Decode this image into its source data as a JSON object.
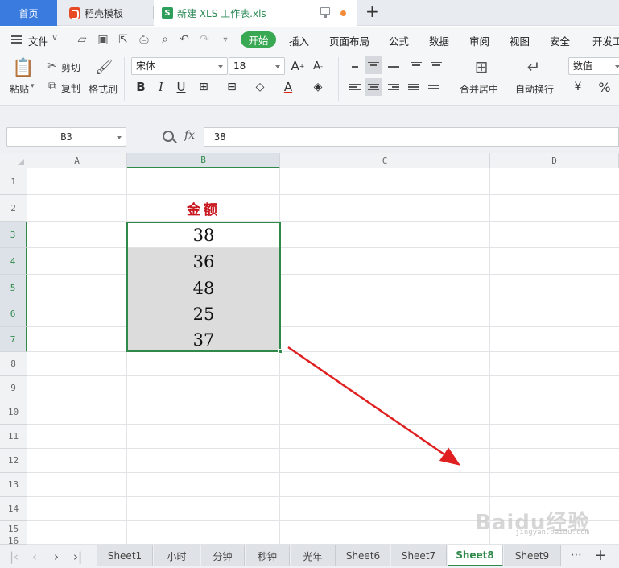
{
  "tabs": {
    "home": "首页",
    "docer": "稻壳模板",
    "document": "新建 XLS 工作表.xls",
    "xls_badge": "S"
  },
  "menu": {
    "file": "文件",
    "items": [
      "开始",
      "插入",
      "页面布局",
      "公式",
      "数据",
      "审阅",
      "视图",
      "安全",
      "开发工"
    ]
  },
  "ribbon": {
    "paste": "粘贴",
    "cut": "剪切",
    "copy": "复制",
    "format_painter": "格式刷",
    "font_name": "宋体",
    "font_size": "18",
    "merge_center": "合并居中",
    "wrap_text": "自动换行",
    "number_format": "数值"
  },
  "formula_bar": {
    "cell_ref": "B3",
    "fx": "fx",
    "value": "38"
  },
  "columns": [
    "A",
    "B",
    "C",
    "D"
  ],
  "rows": [
    "1",
    "2",
    "3",
    "4",
    "5",
    "6",
    "7",
    "8",
    "9",
    "10",
    "11",
    "12",
    "13",
    "14",
    "15",
    "16"
  ],
  "sheet": {
    "header": "金额",
    "values": [
      "38",
      "36",
      "48",
      "25",
      "37"
    ]
  },
  "sheet_tabs": [
    "Sheet1",
    "小时",
    "分钟",
    "秒钟",
    "光年",
    "Sheet6",
    "Sheet7",
    "Sheet8",
    "Sheet9"
  ],
  "active_sheet": "Sheet8",
  "watermark": {
    "brand": "Baidu经验",
    "url": "jingyan.baidu.com"
  },
  "colors": {
    "accent_green": "#2f8a4a",
    "start_button": "#39a852",
    "home_tab": "#3a7be0",
    "header_text": "#c8171e",
    "arrow": "#e02020"
  }
}
